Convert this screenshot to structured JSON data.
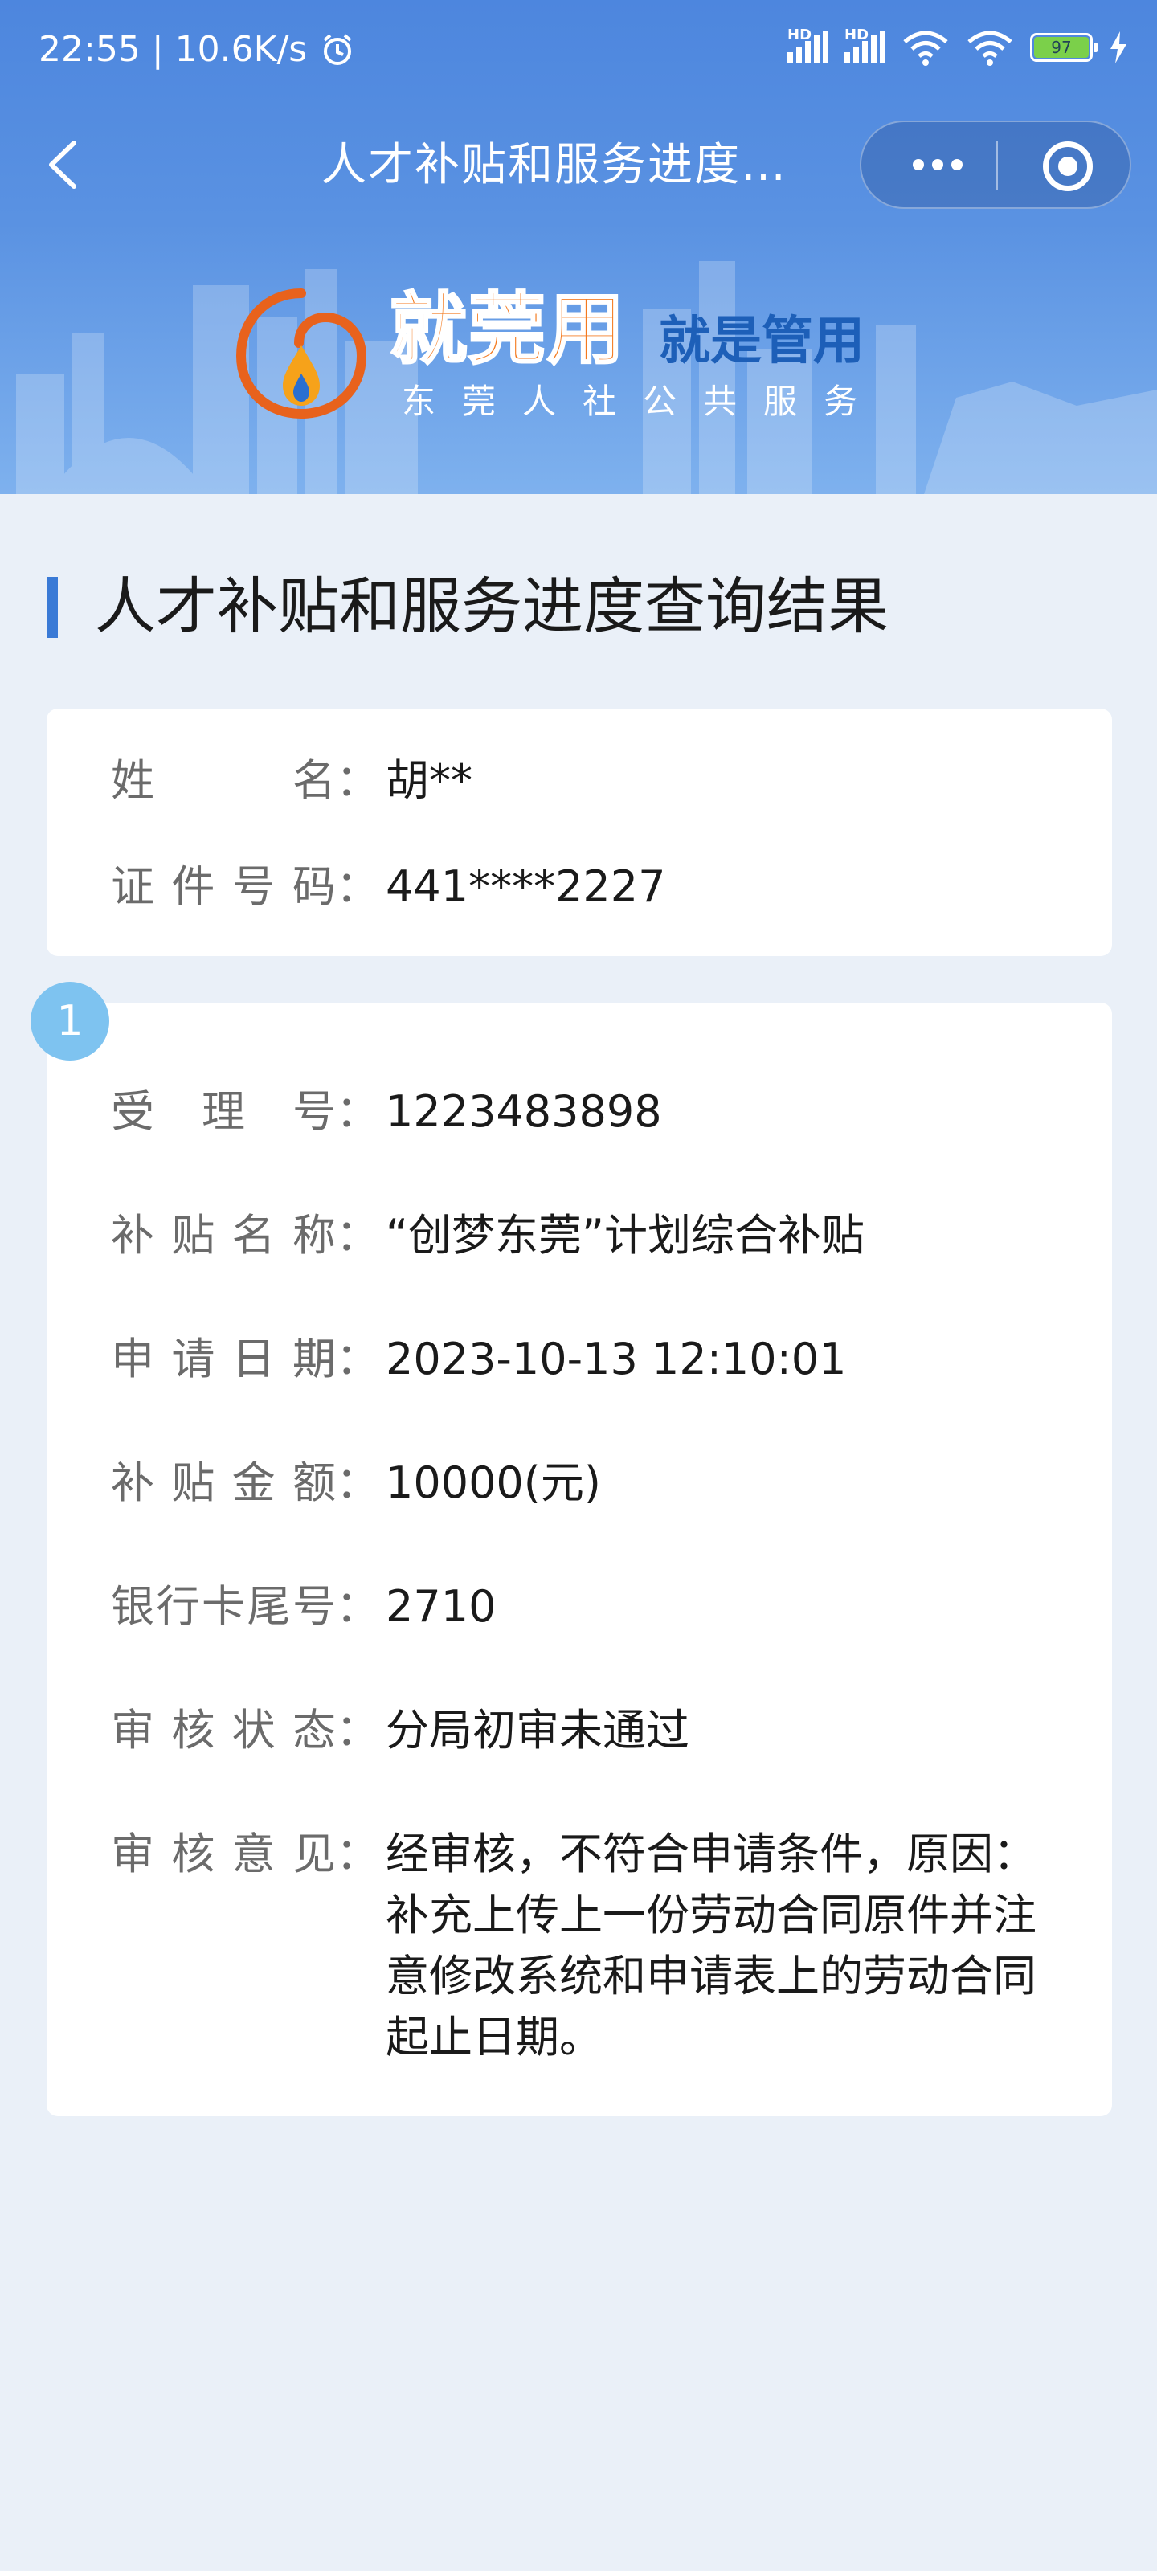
{
  "status_bar": {
    "time": "22:55",
    "speed": "10.6K/s",
    "battery": "97",
    "hd1": "HD",
    "hd2": "HD"
  },
  "nav": {
    "title": "人才补贴和服务进度…"
  },
  "brand": {
    "title": "就莞用",
    "slogan": "就是管用",
    "subtitle": "东莞人社公共服务"
  },
  "page": {
    "section_title": "人才补贴和服务进度查询结果"
  },
  "person": {
    "name_label": "姓名",
    "name_value": "胡**",
    "id_label": "证件号码",
    "id_value": "441****2227"
  },
  "record": {
    "index": "1",
    "fields": [
      {
        "label": "受理号",
        "value": "1223483898"
      },
      {
        "label": "补贴名称",
        "value": "“创梦东莞”计划综合补贴"
      },
      {
        "label": "申请日期",
        "value": "2023-10-13 12:10:01"
      },
      {
        "label": "补贴金额",
        "value": "10000(元)"
      },
      {
        "label": "银行卡尾号",
        "value": "2710"
      },
      {
        "label": "审核状态",
        "value": "分局初审未通过"
      },
      {
        "label": "审核意见",
        "value": "经审核，不符合申请条件，原因：补充上传上一份劳动合同原件并注意修改系统和申请表上的劳动合同起止日期。"
      }
    ]
  },
  "colors": {
    "header_blue": "#4d86de",
    "accent_bar": "#3a7ad6",
    "brand_orange": "#f47a1f",
    "badge": "#7ec3f0",
    "page_bg": "#eaf0f8"
  }
}
